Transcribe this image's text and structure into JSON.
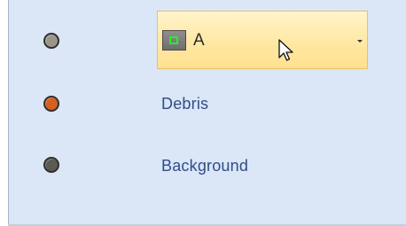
{
  "rows": [
    {
      "dot_color": "#9e958a",
      "label": ""
    },
    {
      "dot_color": "#d45f1e",
      "label": "Debris"
    },
    {
      "dot_color": "#5b5a53",
      "label": "Background"
    }
  ],
  "combo": {
    "text": "A",
    "swatch_icon": "square-outline-icon",
    "arrow_icon": "dropdown-arrow-icon"
  },
  "colors": {
    "panel_bg": "#dbe6f7",
    "label_text": "#2f4e86",
    "combo_hover": "#ffe9a6",
    "swatch_inner": "#2eea2e"
  },
  "cursor": "mouse-pointer-icon"
}
